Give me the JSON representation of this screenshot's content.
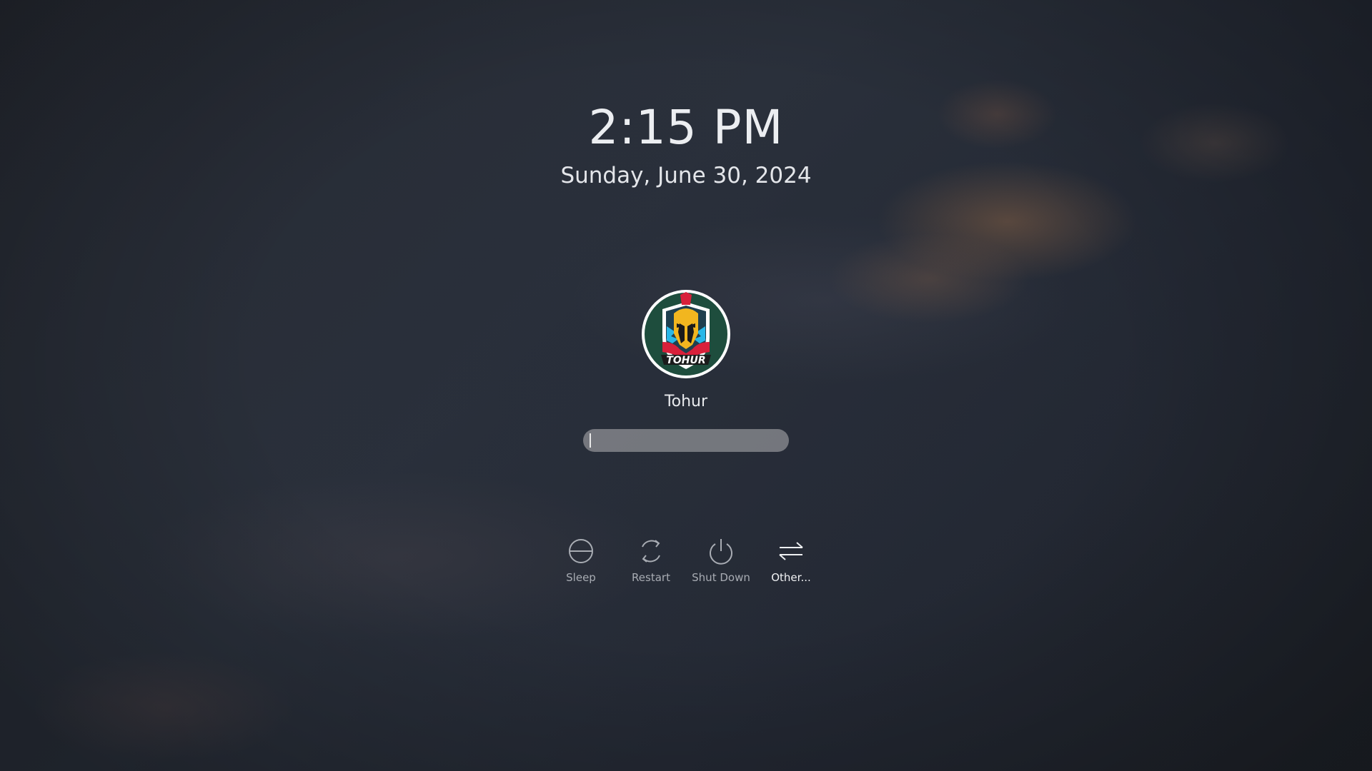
{
  "clock": {
    "time": "2:15 PM",
    "date": "Sunday, June 30, 2024"
  },
  "user": {
    "name": "Tohur",
    "avatar_icon": "spartan-helmet-avatar",
    "avatar_text": "TOHUR"
  },
  "password": {
    "value": "",
    "placeholder": ""
  },
  "actions": [
    {
      "label": "Sleep",
      "icon": "sleep-icon"
    },
    {
      "label": "Restart",
      "icon": "restart-icon"
    },
    {
      "label": "Shut Down",
      "icon": "power-icon"
    },
    {
      "label": "Other...",
      "icon": "switch-arrows-icon"
    }
  ],
  "colors": {
    "background": "#22262e",
    "text": "#eceef1",
    "action_label": "#a8acb3",
    "field": "#a5a5a8",
    "avatar_bg": "#1e4d3d",
    "helmet": "#f2b61f",
    "accent_red": "#d8203a",
    "accent_cyan": "#29b8e8"
  }
}
